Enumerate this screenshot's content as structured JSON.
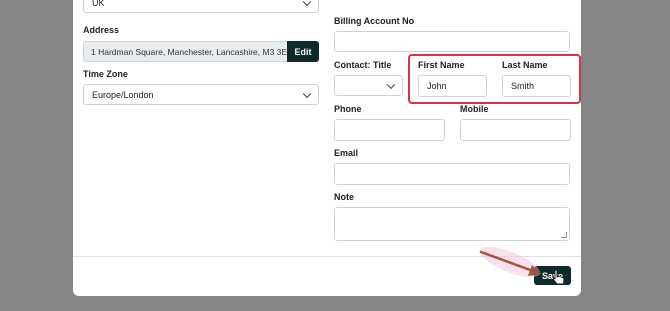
{
  "left": {
    "country_value": "UK",
    "address_label": "Address",
    "address_value": "1 Hardman Square, Manchester, Lancashire, M3 3E",
    "edit_label": "Edit",
    "timezone_label": "Time Zone",
    "timezone_value": "Europe/London"
  },
  "right": {
    "billing_label": "Billing Account No",
    "billing_value": "",
    "title_label": "Contact: Title",
    "title_value": "",
    "first_name_label": "First Name",
    "first_name_value": "John",
    "last_name_label": "Last Name",
    "last_name_value": "Smith",
    "phone_label": "Phone",
    "phone_value": "",
    "mobile_label": "Mobile",
    "mobile_value": "",
    "email_label": "Email",
    "email_value": "",
    "note_label": "Note",
    "note_value": ""
  },
  "footer": {
    "save_label": "Save"
  },
  "colors": {
    "accent_dark": "#0f2a2a",
    "highlight": "#d6324a",
    "arrow": "#a0563e"
  }
}
